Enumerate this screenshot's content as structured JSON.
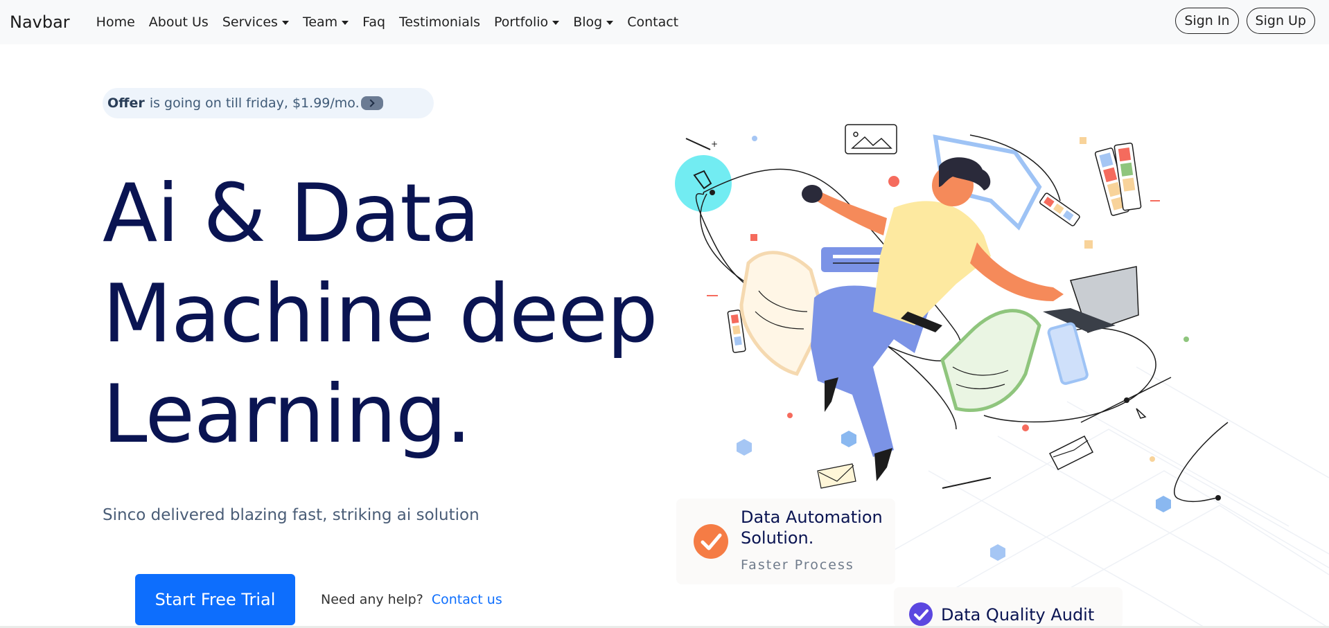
{
  "navbar": {
    "brand": "Navbar",
    "items": [
      {
        "label": "Home",
        "dropdown": false
      },
      {
        "label": "About Us",
        "dropdown": false
      },
      {
        "label": "Services",
        "dropdown": true
      },
      {
        "label": "Team",
        "dropdown": true
      },
      {
        "label": "Faq",
        "dropdown": false
      },
      {
        "label": "Testimonials",
        "dropdown": false
      },
      {
        "label": "Portfolio",
        "dropdown": true
      },
      {
        "label": "Blog",
        "dropdown": true
      },
      {
        "label": "Contact",
        "dropdown": false
      }
    ],
    "sign_in": "Sign In",
    "sign_up": "Sign Up"
  },
  "hero": {
    "offer_bold": "Offer",
    "offer_text": "is going on till friday, $1.99/mo.",
    "title_lines": [
      "Ai & Data",
      "Machine deep",
      "Learning."
    ],
    "subtitle": "Sinco delivered blazing fast, striking ai solution",
    "cta": "Start Free Trial",
    "help_text": "Need any help?",
    "help_link": "Contact us"
  },
  "cards": {
    "card1_title": "Data Automation Solution.",
    "card1_sub": "Faster Process",
    "card2_title": "Data Quality Audit"
  },
  "colors": {
    "title": "#0a1452",
    "accent": "#0d6efd",
    "orange": "#f57c45",
    "purple": "#5b47e0"
  }
}
